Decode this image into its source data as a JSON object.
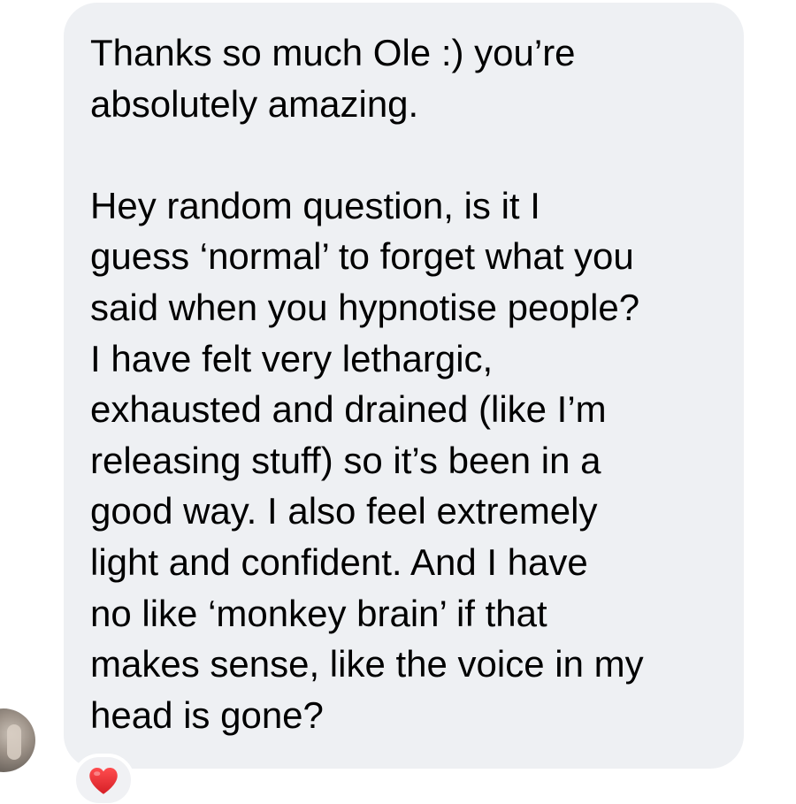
{
  "message": {
    "text": "Thanks so much Ole :) you’re\nabsolutely amazing.\n\nHey random question, is it I\nguess ‘normal’ to forget what you\nsaid when you hypnotise people?\nI have felt very lethargic,\nexhausted and drained (like I’m\nreleasing stuff) so it’s been in a\ngood way. I also feel extremely\nlight and confident. And I have\nno like ‘monkey brain’ if that\nmakes sense, like the voice in my\nhead is gone?"
  },
  "reaction": {
    "icon": "heart-icon",
    "color": "#e3242b"
  },
  "colors": {
    "bubble": "#eef0f3",
    "text": "#000000",
    "background": "#ffffff"
  }
}
